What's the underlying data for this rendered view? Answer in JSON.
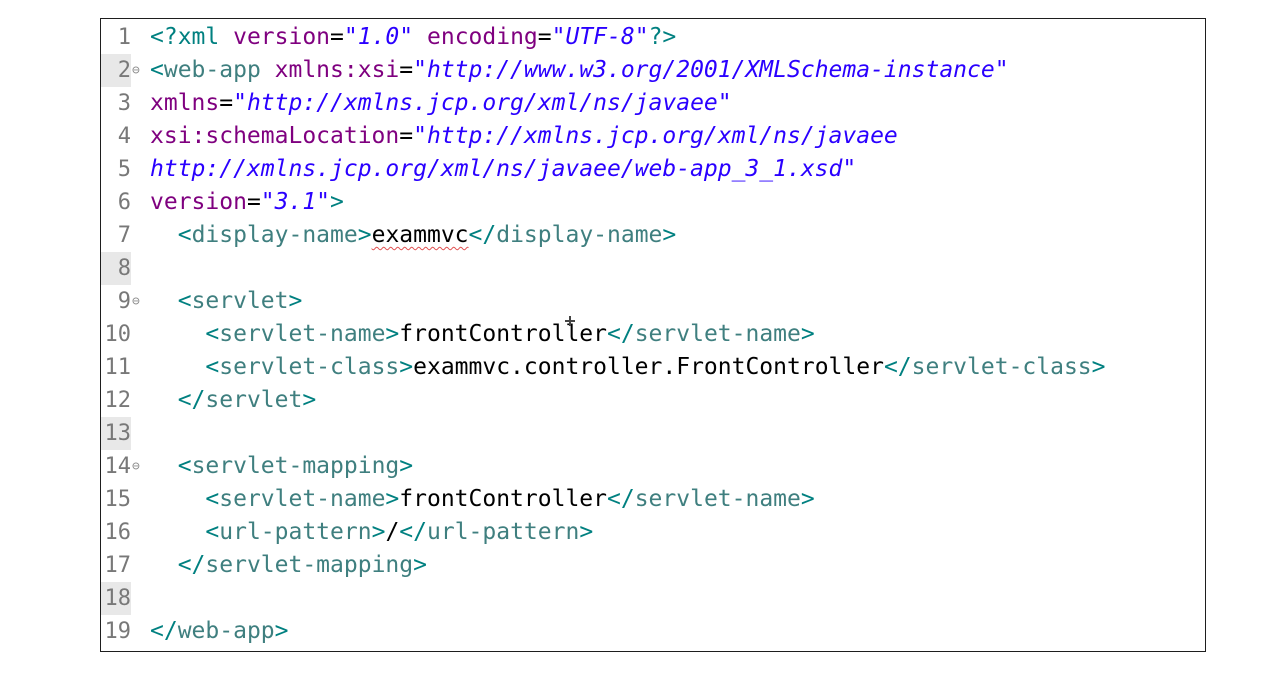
{
  "editor": {
    "lines": [
      {
        "num": "1",
        "fold": "",
        "indent": "",
        "parts": [
          [
            "pi",
            "<?xml "
          ],
          [
            "attr",
            "version"
          ],
          [
            "txt",
            "="
          ],
          [
            "str",
            "\"1.0\""
          ],
          [
            "txt",
            " "
          ],
          [
            "attr",
            "encoding"
          ],
          [
            "txt",
            "="
          ],
          [
            "str",
            "\"UTF-8\""
          ],
          [
            "pi",
            "?>"
          ]
        ]
      },
      {
        "num": "2",
        "fold": "⊖",
        "hl": true,
        "indent": "",
        "parts": [
          [
            "br",
            "<"
          ],
          [
            "tag",
            "web-app "
          ],
          [
            "attr",
            "xmlns:xsi"
          ],
          [
            "txt",
            "="
          ],
          [
            "str",
            "\"http://www.w3.org/2001/XMLSchema-instance\""
          ]
        ]
      },
      {
        "num": "3",
        "fold": "",
        "indent": "",
        "parts": [
          [
            "attr",
            "xmlns"
          ],
          [
            "txt",
            "="
          ],
          [
            "str",
            "\"http://xmlns.jcp.org/xml/ns/javaee\""
          ]
        ]
      },
      {
        "num": "4",
        "fold": "",
        "indent": "",
        "parts": [
          [
            "attr",
            "xsi:schemaLocation"
          ],
          [
            "txt",
            "="
          ],
          [
            "str",
            "\"http://xmlns.jcp.org/xml/ns/javaee"
          ]
        ]
      },
      {
        "num": "5",
        "fold": "",
        "indent": "",
        "parts": [
          [
            "str",
            "http://xmlns.jcp.org/xml/ns/javaee/web-app_3_1.xsd\""
          ]
        ]
      },
      {
        "num": "6",
        "fold": "",
        "indent": "",
        "parts": [
          [
            "attr",
            "version"
          ],
          [
            "txt",
            "="
          ],
          [
            "str",
            "\"3.1\""
          ],
          [
            "br",
            ">"
          ]
        ]
      },
      {
        "num": "7",
        "fold": "",
        "indent": "  ",
        "parts": [
          [
            "br",
            "<"
          ],
          [
            "tag",
            "display-name"
          ],
          [
            "br",
            ">"
          ],
          [
            "squig",
            "exammvc"
          ],
          [
            "br",
            "</"
          ],
          [
            "tag",
            "display-name"
          ],
          [
            "br",
            ">"
          ]
        ]
      },
      {
        "num": "8",
        "fold": "",
        "hl": true,
        "indent": "",
        "parts": []
      },
      {
        "num": "9",
        "fold": "⊖",
        "indent": "  ",
        "parts": [
          [
            "br",
            "<"
          ],
          [
            "tag",
            "servlet"
          ],
          [
            "br",
            ">"
          ]
        ]
      },
      {
        "num": "10",
        "fold": "",
        "indent": "    ",
        "parts": [
          [
            "br",
            "<"
          ],
          [
            "tag",
            "servlet-name"
          ],
          [
            "br",
            ">"
          ],
          [
            "txt",
            "frontController"
          ],
          [
            "br",
            "</"
          ],
          [
            "tag",
            "servlet-name"
          ],
          [
            "br",
            ">"
          ]
        ]
      },
      {
        "num": "11",
        "fold": "",
        "indent": "    ",
        "parts": [
          [
            "br",
            "<"
          ],
          [
            "tag",
            "servlet-class"
          ],
          [
            "br",
            ">"
          ],
          [
            "txt",
            "exammvc.controller.FrontController"
          ],
          [
            "br",
            "</"
          ],
          [
            "tag",
            "servlet-class"
          ],
          [
            "br",
            ">"
          ]
        ]
      },
      {
        "num": "12",
        "fold": "",
        "indent": "  ",
        "parts": [
          [
            "br",
            "</"
          ],
          [
            "tag",
            "servlet"
          ],
          [
            "br",
            ">"
          ]
        ]
      },
      {
        "num": "13",
        "fold": "",
        "hl": true,
        "indent": "",
        "parts": []
      },
      {
        "num": "14",
        "fold": "⊖",
        "indent": "  ",
        "parts": [
          [
            "br",
            "<"
          ],
          [
            "tag",
            "servlet-mapping"
          ],
          [
            "br",
            ">"
          ]
        ]
      },
      {
        "num": "15",
        "fold": "",
        "indent": "    ",
        "parts": [
          [
            "br",
            "<"
          ],
          [
            "tag",
            "servlet-name"
          ],
          [
            "br",
            ">"
          ],
          [
            "txt",
            "frontController"
          ],
          [
            "br",
            "</"
          ],
          [
            "tag",
            "servlet-name"
          ],
          [
            "br",
            ">"
          ]
        ]
      },
      {
        "num": "16",
        "fold": "",
        "indent": "    ",
        "parts": [
          [
            "br",
            "<"
          ],
          [
            "tag",
            "url-pattern"
          ],
          [
            "br",
            ">"
          ],
          [
            "txt",
            "/"
          ],
          [
            "br",
            "</"
          ],
          [
            "tag",
            "url-pattern"
          ],
          [
            "br",
            ">"
          ]
        ]
      },
      {
        "num": "17",
        "fold": "",
        "indent": "  ",
        "parts": [
          [
            "br",
            "</"
          ],
          [
            "tag",
            "servlet-mapping"
          ],
          [
            "br",
            ">"
          ]
        ]
      },
      {
        "num": "18",
        "fold": "",
        "hl": true,
        "indent": "",
        "parts": []
      },
      {
        "num": "19",
        "fold": "",
        "indent": "",
        "parts": [
          [
            "br",
            "</"
          ],
          [
            "tag",
            "web-app"
          ],
          [
            "br",
            ">"
          ]
        ]
      }
    ]
  }
}
